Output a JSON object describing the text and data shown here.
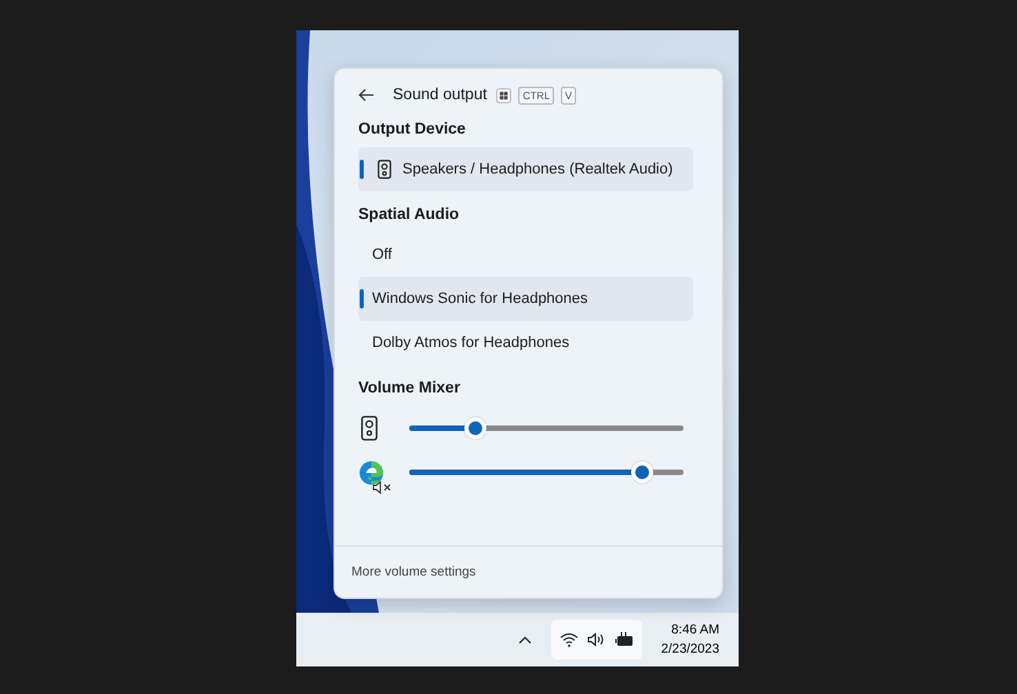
{
  "panel": {
    "title": "Sound output",
    "shortcut_keys": [
      "CTRL",
      "V"
    ],
    "output_device": {
      "heading": "Output Device",
      "devices": [
        {
          "label": "Speakers / Headphones (Realtek Audio)",
          "selected": true
        }
      ]
    },
    "spatial_audio": {
      "heading": "Spatial Audio",
      "options": [
        {
          "label": "Off",
          "selected": false
        },
        {
          "label": "Windows Sonic for Headphones",
          "selected": true
        },
        {
          "label": "Dolby Atmos for Headphones",
          "selected": false
        }
      ]
    },
    "volume_mixer": {
      "heading": "Volume Mixer",
      "apps": [
        {
          "kind": "speaker",
          "level": 0.24,
          "muted": false
        },
        {
          "kind": "browser",
          "level": 0.85,
          "muted": true
        }
      ]
    },
    "footer_link": "More volume settings"
  },
  "taskbar": {
    "time": "8:46 AM",
    "date": "2/23/2023"
  }
}
